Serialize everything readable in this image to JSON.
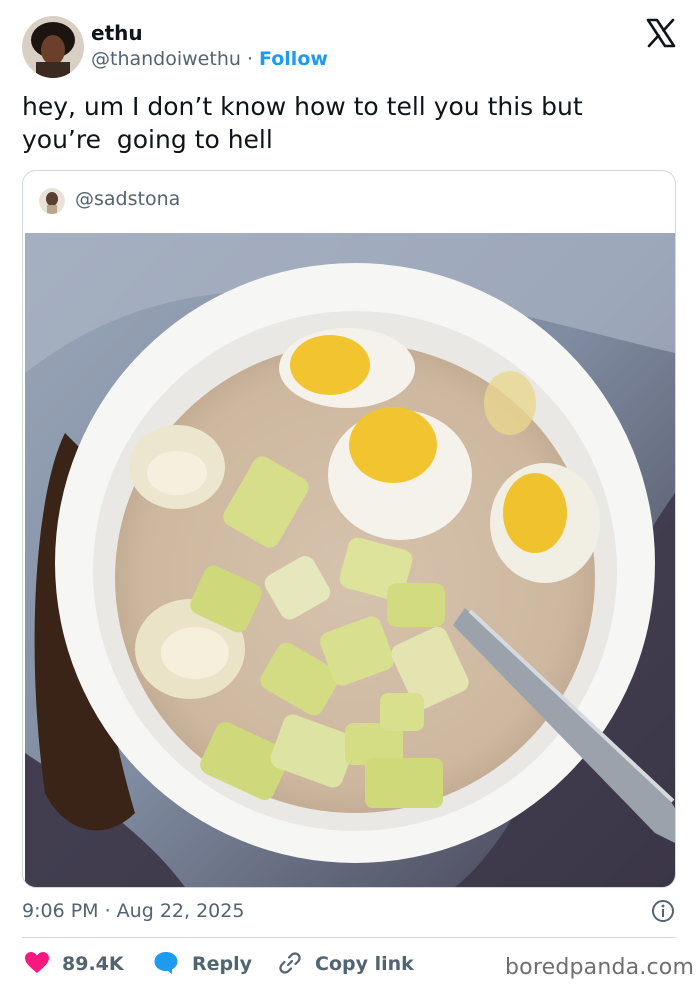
{
  "author": {
    "name": "ethu",
    "handle": "@thandoiwethu",
    "separator": " · ",
    "follow_label": "Follow"
  },
  "tweet": {
    "text": "hey, um I don’t know how to tell you this but\nyou’re  going to hell"
  },
  "quoted": {
    "handle": "@sadstona"
  },
  "meta": {
    "timestamp": "9:06 PM · Aug 22, 2025"
  },
  "actions": {
    "likes": "89.4K",
    "reply_label": "Reply",
    "copy_link_label": "Copy link"
  },
  "watermark": "boredpanda.com",
  "colors": {
    "accent": "#1d9bf0",
    "heart": "#f91880",
    "secondary_text": "#536471",
    "border": "#cfd9de"
  },
  "icons": [
    "x-logo-icon",
    "info-icon",
    "heart-icon",
    "reply-bubble-icon",
    "link-icon"
  ]
}
